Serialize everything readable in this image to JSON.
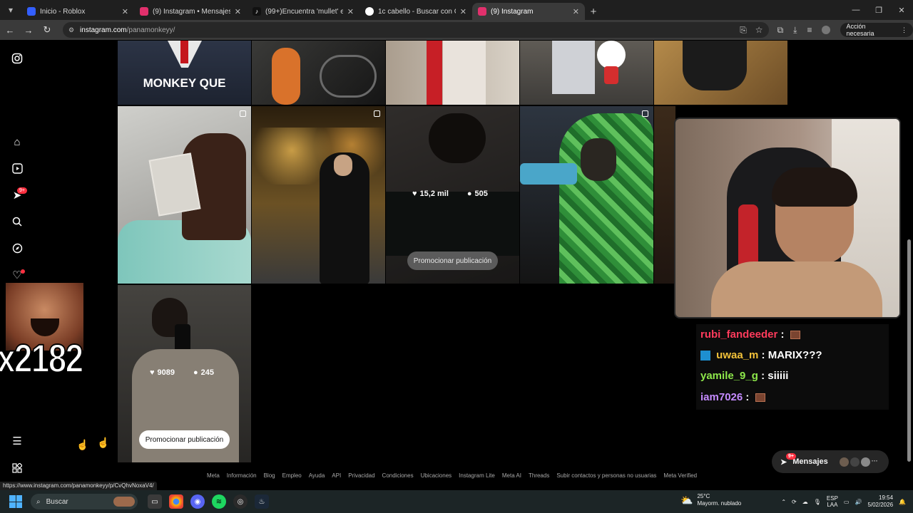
{
  "browser": {
    "tabs": [
      {
        "title": "Inicio - Roblox",
        "color": "#335fff",
        "active": false
      },
      {
        "title": "(9) Instagram • Mensajes",
        "color": "#e1306c",
        "active": false
      },
      {
        "title": "(99+)Encuentra 'mullet' en TikT",
        "color": "#111111",
        "active": false
      },
      {
        "title": "1c cabello - Buscar con Google",
        "color": "#ffffff",
        "active": false
      },
      {
        "title": "(9) Instagram",
        "color": "#e1306c",
        "active": true
      }
    ],
    "url_host": "instagram.com",
    "url_path": "/panamonkeyy/",
    "accion_label": "Acción necesaria"
  },
  "sidebar": {
    "notifications_badge": "9+"
  },
  "grid": {
    "top_row_caption": "MONKEY QUE",
    "post_stats_1": {
      "likes": "15,2 mil",
      "comments": "505"
    },
    "post_stats_2": {
      "likes": "9089",
      "comments": "245"
    },
    "promote_label": "Promocionar publicación"
  },
  "chat": {
    "line0": "rubi_fandeeder",
    "line1_user": "uwaa_m",
    "line1_msg": "MARIX???",
    "line2_user": "yamile_9_g",
    "line2_msg": "siiiii",
    "line3_user": "iam7026",
    "colors": {
      "rubi": "#ff3b5c",
      "uwaa": "#f3c23a",
      "yamile": "#8ee84b",
      "iam": "#c58bff"
    }
  },
  "overlay": {
    "counter": "x2182"
  },
  "messages": {
    "label": "Mensajes",
    "badge": "9+"
  },
  "footer": {
    "links": [
      "Meta",
      "Información",
      "Blog",
      "Empleo",
      "Ayuda",
      "API",
      "Privacidad",
      "Condiciones",
      "Ubicaciones",
      "Instagram Lite",
      "Meta AI",
      "Threads",
      "Subir contactos y personas no usuarias",
      "Meta Verified"
    ]
  },
  "status_url": "https://www.instagram.com/panamonkeyy/p/CvQhvNoxaV4/",
  "taskbar": {
    "search_placeholder": "Buscar",
    "weather_temp": "25°C",
    "weather_desc": "Mayorm. nublado",
    "lang_top": "ESP",
    "lang_bottom": "LAA",
    "time": "19:54",
    "date": "5/02/2026"
  }
}
